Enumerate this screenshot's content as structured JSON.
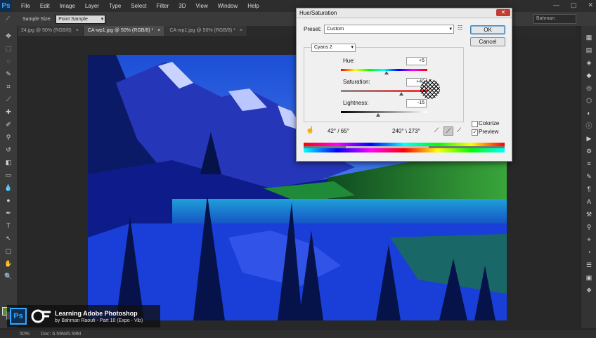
{
  "app": {
    "logo": "Ps",
    "window_controls": [
      "—",
      "▢",
      "✕"
    ]
  },
  "menu": [
    "File",
    "Edit",
    "Image",
    "Layer",
    "Type",
    "Select",
    "Filter",
    "3D",
    "View",
    "Window",
    "Help"
  ],
  "options_bar": {
    "label": "Sample Size:",
    "value": "Point Sample",
    "workspace": "Bahman"
  },
  "tabs": [
    {
      "label": "24.jpg @ 50% (RGB/8)",
      "close": "×"
    },
    {
      "label": "CA-wp1.jpg @ 50% (RGB/8) *",
      "close": "×"
    },
    {
      "label": "CA-wp1.jpg @ 50% (RGB/8) *",
      "close": "×"
    }
  ],
  "dialog": {
    "title": "Hue/Saturation",
    "close": "✕",
    "preset_label": "Preset:",
    "preset_value": "Custom",
    "ok": "OK",
    "cancel": "Cancel",
    "channel": "Cyans 2",
    "hue_label": "Hue:",
    "hue_value": "+5",
    "saturation_label": "Saturation:",
    "saturation_value": "+40",
    "lightness_label": "Lightness:",
    "lightness_value": "-15",
    "colorize": "Colorize",
    "preview": "Preview",
    "range_left": "42° / 65°",
    "range_right": "240° \\ 273°",
    "hue_level": 0.53,
    "saturation_level": 0.7,
    "lightness_level": 0.43
  },
  "watermark": {
    "logo": "Ps",
    "title": "Learning Adobe Photoshop",
    "subtitle": "by Bahman Raoufi - Part 10 (Expo - Vib)"
  },
  "status": {
    "zoom": "50%",
    "doc": "Doc: 6.59M/6.59M"
  },
  "colors": {
    "foreground": "#5f8a2c",
    "background": "#ffffff",
    "ps_blue": "#31a8ff"
  }
}
